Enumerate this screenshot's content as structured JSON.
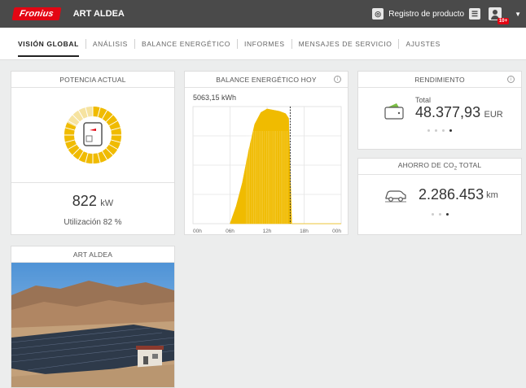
{
  "header": {
    "logo": "Fronius",
    "title": "ART ALDEA",
    "register_label": "Registro de producto",
    "notification_badge": "10+"
  },
  "nav": {
    "tabs": [
      "VISIÓN GLOBAL",
      "ANÁLISIS",
      "BALANCE ENERGÉTICO",
      "INFORMES",
      "MENSAJES DE SERVICIO",
      "AJUSTES"
    ],
    "active": 0
  },
  "power": {
    "title": "POTENCIA ACTUAL",
    "value": "822",
    "unit": "kW",
    "utilization": "Utilización 82 %",
    "gauge_fraction": 0.82,
    "gauge_color": "#f0bb00",
    "gauge_empty_color": "#f6e3a0"
  },
  "balance": {
    "title": "BALANCE ENERGÉTICO HOY",
    "total": "5063,15 kWh"
  },
  "chart_data": {
    "type": "area",
    "x_ticks": [
      "00h",
      "06h",
      "12h",
      "18h",
      "00h"
    ],
    "x": [
      6,
      7,
      8,
      9,
      10,
      11,
      12,
      13,
      14,
      15,
      15.5,
      16,
      17,
      18,
      24
    ],
    "values": [
      0,
      15,
      35,
      62,
      85,
      95,
      98,
      97,
      96,
      94,
      90,
      0,
      0,
      0,
      0
    ],
    "now_marker_hour": 15.75,
    "fill_color": "#f0bb00",
    "grid": true
  },
  "yield": {
    "title": "RENDIMIENTO",
    "label": "Total",
    "value": "48.377,93",
    "currency": "EUR",
    "pages": 4,
    "active_page": 3
  },
  "co2": {
    "title_prefix": "AHORRO DE CO",
    "title_sub": "2",
    "title_suffix": " TOTAL",
    "value": "2.286.453",
    "unit": "km",
    "pages": 3,
    "active_page": 2
  },
  "plant": {
    "title": "ART ALDEA"
  }
}
